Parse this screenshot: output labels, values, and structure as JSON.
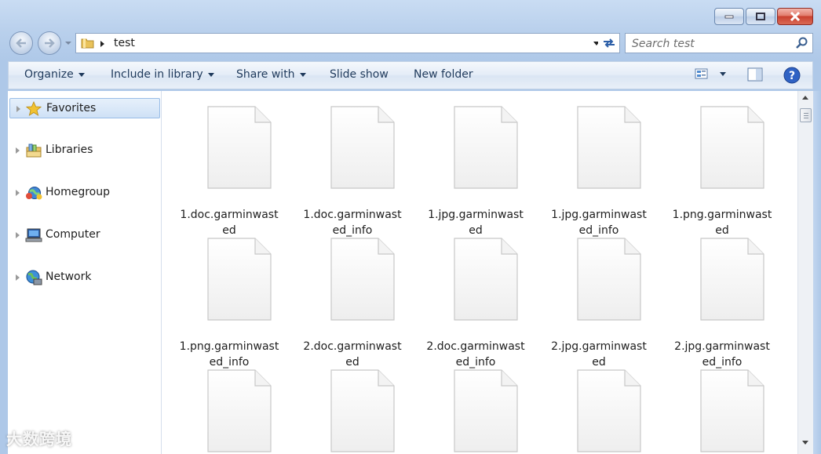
{
  "window": {
    "caption": {
      "minimize": "minimize-icon",
      "maximize": "maximize-icon",
      "close": "close-icon"
    }
  },
  "address_bar": {
    "path": [
      "test"
    ],
    "search_placeholder": "Search test"
  },
  "toolbar": {
    "organize": "Organize",
    "include_in_library": "Include in library",
    "share_with": "Share with",
    "slide_show": "Slide show",
    "new_folder": "New folder"
  },
  "nav_pane": {
    "items": [
      {
        "label": "Favorites",
        "icon": "star-icon",
        "selected": true
      },
      {
        "label": "Libraries",
        "icon": "libraries-icon",
        "selected": false
      },
      {
        "label": "Homegroup",
        "icon": "homegroup-icon",
        "selected": false
      },
      {
        "label": "Computer",
        "icon": "computer-icon",
        "selected": false
      },
      {
        "label": "Network",
        "icon": "network-icon",
        "selected": false
      }
    ]
  },
  "files": [
    {
      "line1": "1.doc.garminwast",
      "line2": "ed"
    },
    {
      "line1": "1.doc.garminwast",
      "line2": "ed_info"
    },
    {
      "line1": "1.jpg.garminwast",
      "line2": "ed"
    },
    {
      "line1": "1.jpg.garminwast",
      "line2": "ed_info"
    },
    {
      "line1": "1.png.garminwast",
      "line2": "ed"
    },
    {
      "line1": "1.png.garminwast",
      "line2": "ed_info"
    },
    {
      "line1": "2.doc.garminwast",
      "line2": "ed"
    },
    {
      "line1": "2.doc.garminwast",
      "line2": "ed_info"
    },
    {
      "line1": "2.jpg.garminwast",
      "line2": "ed"
    },
    {
      "line1": "2.jpg.garminwast",
      "line2": "ed_info"
    },
    {
      "line1": "",
      "line2": ""
    },
    {
      "line1": "",
      "line2": ""
    },
    {
      "line1": "",
      "line2": ""
    },
    {
      "line1": "",
      "line2": ""
    },
    {
      "line1": "",
      "line2": ""
    }
  ],
  "watermark": "大数跨境",
  "colors": {
    "accent": "#1e395b",
    "selection": "#cfe1f6",
    "frame": "#b9d0ec"
  }
}
